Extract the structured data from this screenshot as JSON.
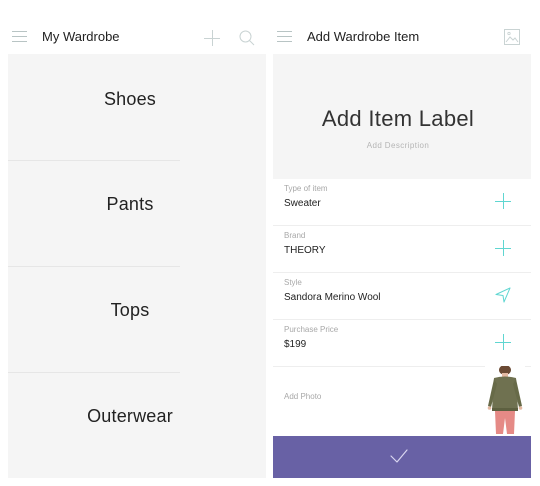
{
  "wardrobe": {
    "title": "My Wardrobe",
    "menu_icon": "hamburger-menu-icon",
    "add_icon": "plus-icon",
    "search_icon": "search-icon",
    "categories": [
      {
        "label": "Shoes"
      },
      {
        "label": "Pants"
      },
      {
        "label": "Tops"
      },
      {
        "label": "Outerwear"
      }
    ]
  },
  "add_item": {
    "title": "Add Wardrobe Item",
    "menu_icon": "hamburger-menu-icon",
    "image_icon": "image-icon",
    "label_placeholder": "Add Item Label",
    "description_placeholder": "Add Description",
    "fields": [
      {
        "label": "Type of item",
        "value": "Sweater",
        "icon": "plus-icon"
      },
      {
        "label": "Brand",
        "value": "THEORY",
        "icon": "plus-icon"
      },
      {
        "label": "Style",
        "value": "Sandora Merino Wool",
        "icon": "location-arrow-icon"
      },
      {
        "label": "Purchase Price",
        "value": "$199",
        "icon": "plus-icon"
      }
    ],
    "photo_label": "Add Photo",
    "submit_icon": "checkmark-icon"
  },
  "colors": {
    "accent": "#5fd6d1",
    "submit_bar": "#6861a5",
    "panel_bg": "#f5f5f5"
  }
}
